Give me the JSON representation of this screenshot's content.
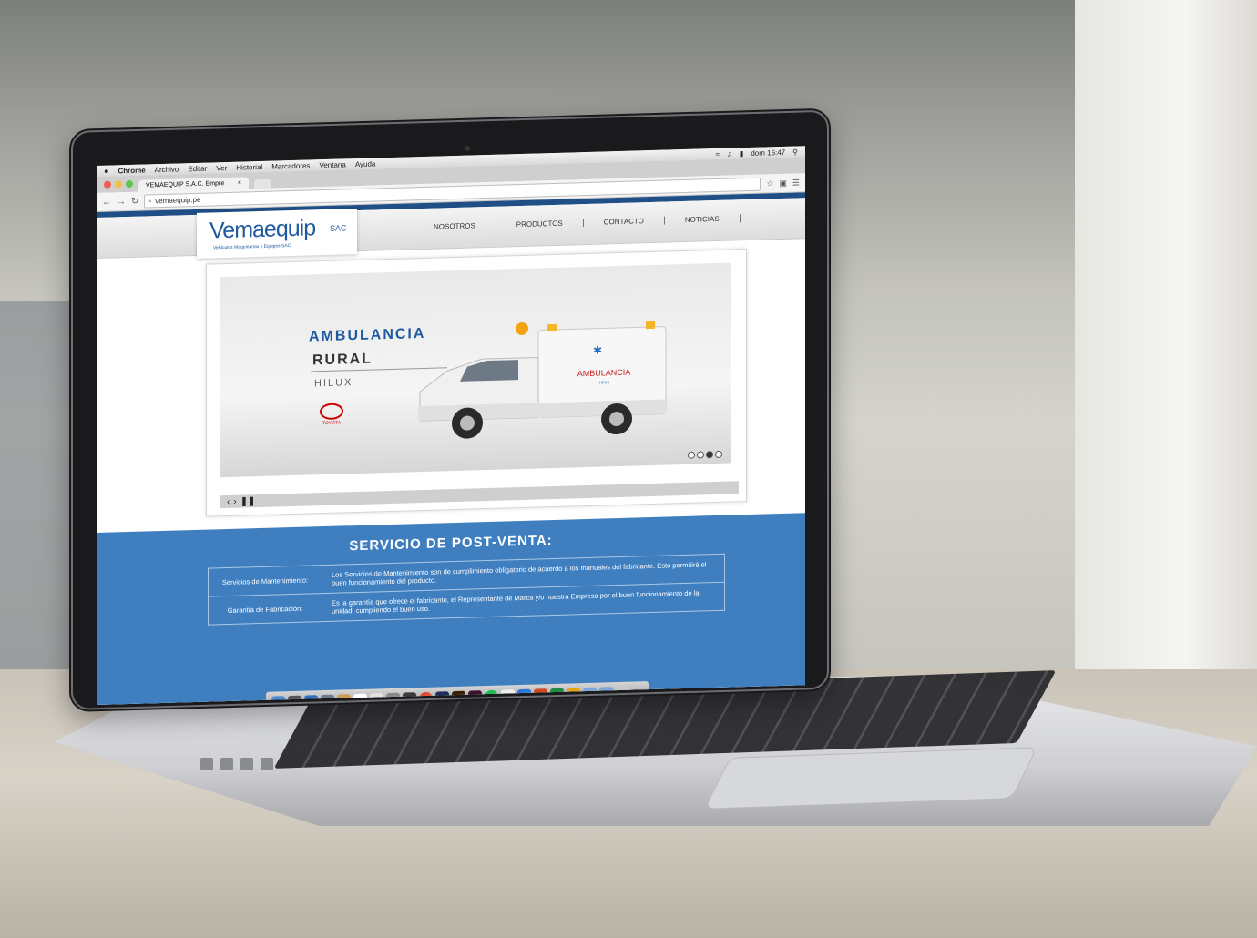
{
  "os_menubar": {
    "apple": "",
    "app": "Chrome",
    "items": [
      "Archivo",
      "Editar",
      "Ver",
      "Historial",
      "Marcadores",
      "Ventana",
      "Ayuda"
    ],
    "clock": "dom 15:47"
  },
  "browser": {
    "tab_title": "VEMAEQUIP S.A.C. Empre",
    "tab_close": "×",
    "url": "vemaequip.pe"
  },
  "site": {
    "logo_word": "Vemaequip",
    "logo_sac": "SAC",
    "logo_tagline": "Vehículos Maquinarias y Equipos    SAC",
    "nav": [
      "NOSOTROS",
      "PRODUCTOS",
      "CONTACTO",
      "NOTICIAS"
    ],
    "slide": {
      "line1": "AMBULANCIA",
      "line2": "RURAL",
      "line3": "HILUX",
      "brand": "TOYOTA",
      "vehicle_label": "AMBULANCIA",
      "vehicle_sub": "TIPO I"
    },
    "slider_dots": 4,
    "slider_active_dot": 3,
    "service": {
      "title": "SERVICIO DE POST-VENTA:",
      "rows": [
        {
          "k": "Servicios de Mantenimiento:",
          "v": "Los Servicios de Mantenimiento son de cumplimiento obligatorio de acuerdo a los manuales del fabricante. Esto permitirá el buen funcionamiento del producto."
        },
        {
          "k": "Garantía de Fabricación:",
          "v": "Es la garantía que ofrece el fabricante, el Representante de Marca y/o nuestra Empresa por el buen funcionamiento de la unidad, cumpliendo el buen uso."
        }
      ]
    }
  },
  "colors": {
    "brand_blue": "#1f5aa0",
    "band_blue": "#3f7fc0"
  }
}
